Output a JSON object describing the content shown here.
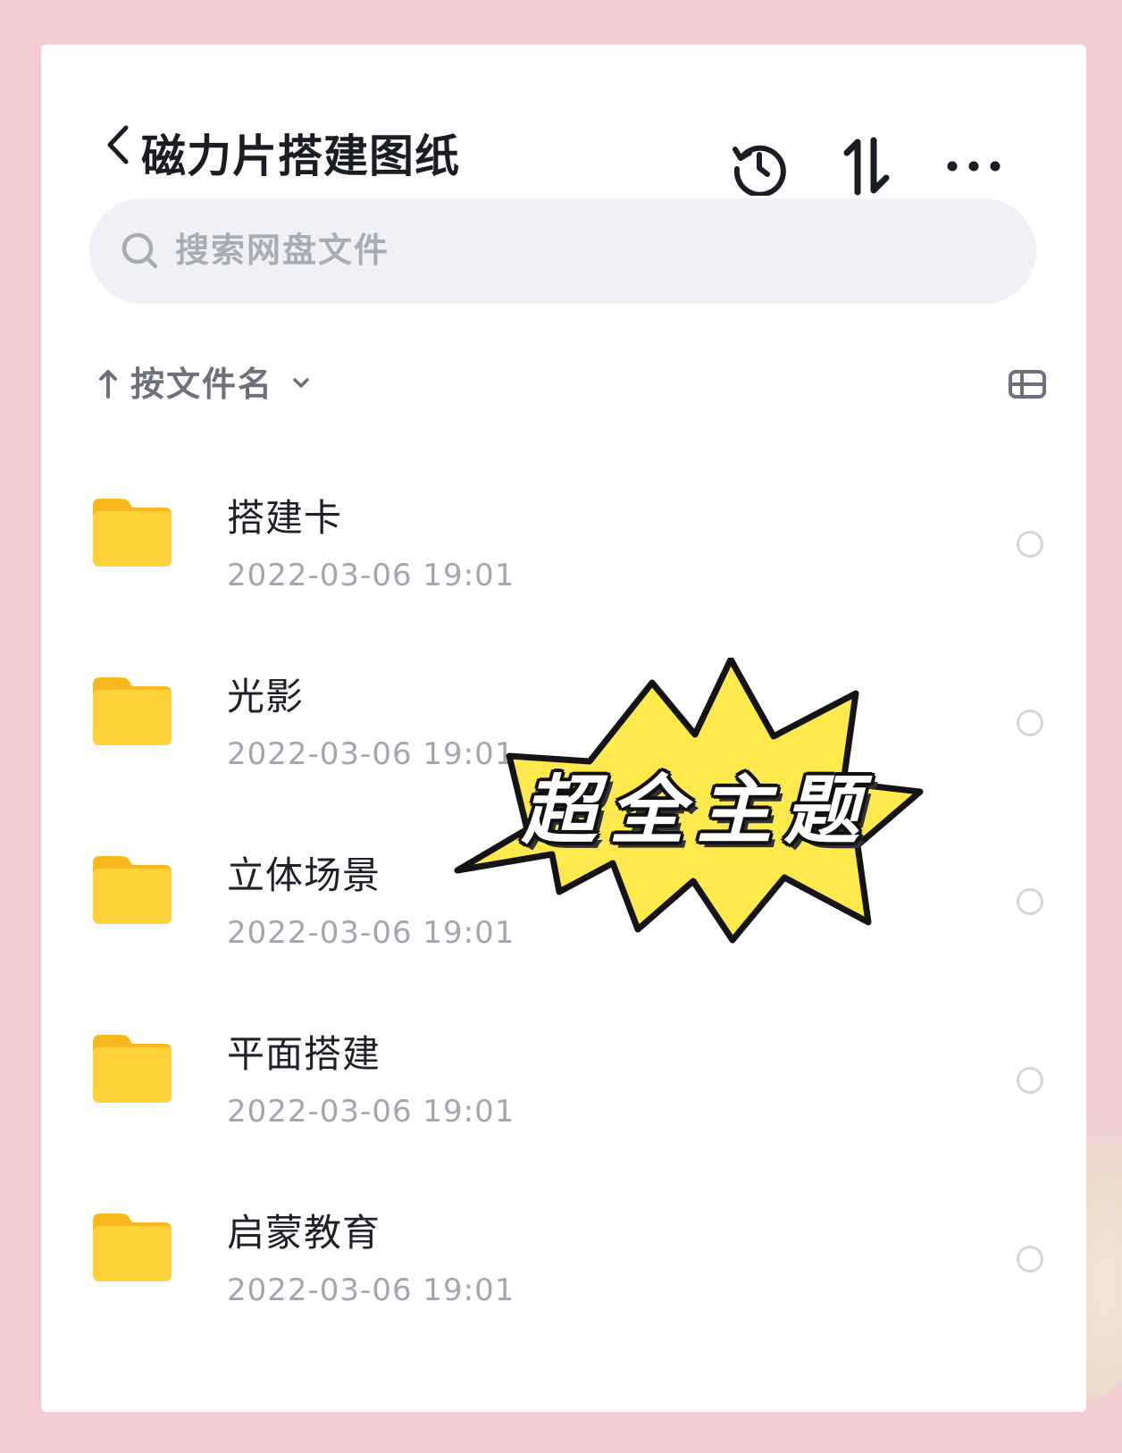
{
  "header": {
    "title": "磁力片搭建图纸"
  },
  "search": {
    "placeholder": "搜索网盘文件"
  },
  "sort": {
    "label": "按文件名"
  },
  "files": [
    {
      "name": "搭建卡",
      "date": "2022-03-06 19:01"
    },
    {
      "name": "光影",
      "date": "2022-03-06 19:01"
    },
    {
      "name": "立体场景",
      "date": "2022-03-06 19:01"
    },
    {
      "name": "平面搭建",
      "date": "2022-03-06 19:01"
    },
    {
      "name": "启蒙教育",
      "date": "2022-03-06 19:01"
    }
  ],
  "overlay": {
    "text": "超全主题"
  },
  "colors": {
    "background": "#f4cdd2",
    "folder": "#ffc928",
    "burst": "#ffe94d"
  },
  "icons": [
    "back-icon",
    "history-icon",
    "sort-order-icon",
    "more-icon",
    "search-icon",
    "sort-arrow-icon",
    "chevron-down-icon",
    "view-toggle-icon",
    "folder-icon"
  ]
}
